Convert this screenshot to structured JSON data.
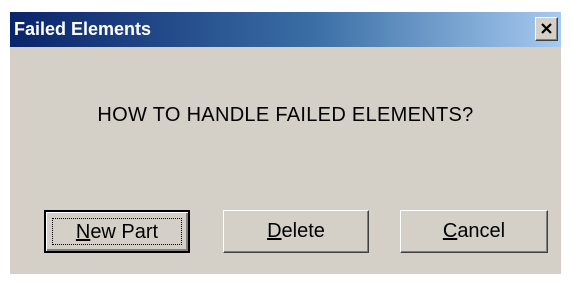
{
  "window": {
    "title": "Failed Elements",
    "close_icon": "close-x-icon"
  },
  "message": "HOW TO HANDLE FAILED ELEMENTS?",
  "buttons": {
    "new_part": {
      "mnemonic": "N",
      "rest": "ew Part",
      "default": true
    },
    "delete": {
      "mnemonic": "D",
      "rest": "elete"
    },
    "cancel": {
      "mnemonic": "C",
      "rest": "ancel"
    }
  }
}
